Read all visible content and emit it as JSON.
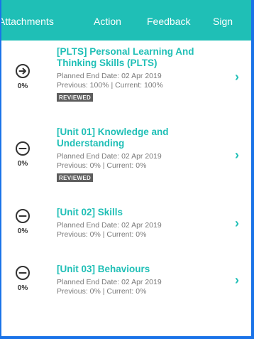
{
  "tabs": [
    "Attachments",
    "Action",
    "Feedback",
    "Sign"
  ],
  "items": [
    {
      "title": "[PLTS] Personal Learning And Thinking Skills (PLTS)",
      "planned": "Planned End Date: 02 Apr 2019",
      "progress": "Previous: 100% | Current: 100%",
      "badge": "REVIEWED",
      "percent": "0%",
      "status_icon": "arrow-right-circle-icon"
    },
    {
      "title": "[Unit 01] Knowledge and Understanding",
      "planned": "Planned End Date: 02 Apr 2019",
      "progress": "Previous: 0% | Current: 0%",
      "badge": "REVIEWED",
      "percent": "0%",
      "status_icon": "minus-circle-icon"
    },
    {
      "title": "[Unit 02] Skills",
      "planned": "Planned End Date: 02 Apr 2019",
      "progress": "Previous: 0% | Current: 0%",
      "percent": "0%",
      "status_icon": "minus-circle-icon"
    },
    {
      "title": "[Unit 03] Behaviours",
      "planned": "Planned End Date: 02 Apr 2019",
      "progress": "Previous: 0% | Current: 0%",
      "percent": "0%",
      "status_icon": "minus-circle-icon"
    }
  ],
  "chevron": "›",
  "colors": {
    "accent": "#1fbfb6",
    "badge": "#5d5d5d",
    "meta_text": "#7a7a7a"
  }
}
